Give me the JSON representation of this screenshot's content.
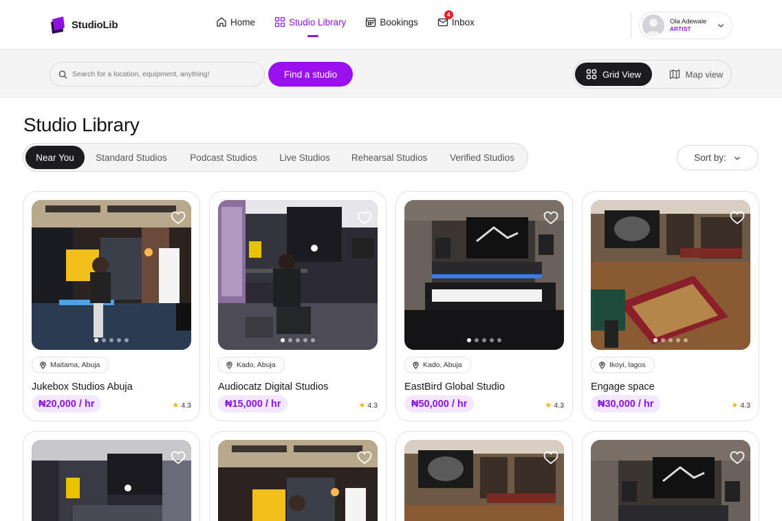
{
  "brand": {
    "name": "StudioLib",
    "accent": "#9b10ee"
  },
  "nav": {
    "items": [
      {
        "label": "Home",
        "icon": "home-icon"
      },
      {
        "label": "Studio Library",
        "icon": "grid-icon"
      },
      {
        "label": "Bookings",
        "icon": "calendar-icon"
      },
      {
        "label": "Inbox",
        "icon": "mail-icon"
      }
    ],
    "active": "Studio Library",
    "inbox_count": "4"
  },
  "user": {
    "name": "Ola Adewale",
    "role": "ARTIST"
  },
  "search": {
    "placeholder": "Search for a location, equipment, anything!",
    "button": "Find a studio"
  },
  "view": {
    "grid_label": "Grid View",
    "map_label": "Map view",
    "active": "Grid View"
  },
  "page": {
    "title": "Studio Library"
  },
  "filters": {
    "tabs": [
      "Near You",
      "Standard Studios",
      "Podcast Studios",
      "Live Studios",
      "Rehearsal Studios",
      "Verified Studios"
    ],
    "active": "Near You",
    "sort_label": "Sort by:"
  },
  "studios": [
    {
      "location": "Maitama, Abuja",
      "name": "Jukebox Studios Abuja",
      "price": "₦20,000 / hr",
      "rating": "4.3"
    },
    {
      "location": "Kado, Abuja",
      "name": "Audiocatz Digital Studios",
      "price": "₦15,000 / hr",
      "rating": "4.3"
    },
    {
      "location": "Kado, Abuja",
      "name": "EastBird Global Studio",
      "price": "₦50,000 / hr",
      "rating": "4.3"
    },
    {
      "location": "Ikoyi, lagos",
      "name": "Engage space",
      "price": "₦30,000 / hr",
      "rating": "4.3"
    }
  ]
}
